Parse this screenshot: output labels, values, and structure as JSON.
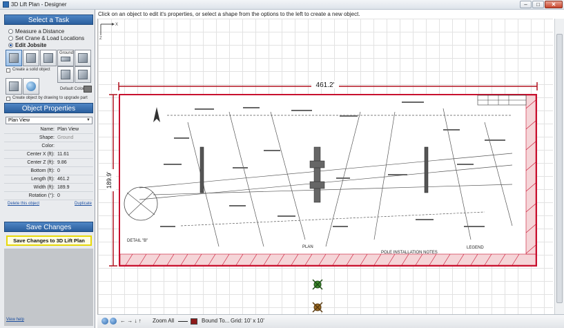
{
  "window": {
    "title": "3D Lift Plan - Designer",
    "minimize_glyph": "–",
    "maximize_glyph": "□",
    "close_glyph": "✕"
  },
  "left_panel": {
    "task_header": "Select a Task",
    "tasks": [
      {
        "label": "Measure a Distance",
        "selected": false
      },
      {
        "label": "Set Crane & Load Locations",
        "selected": false
      },
      {
        "label": "Edit Jobsite",
        "selected": true
      }
    ],
    "shape_labels": {
      "create_solid": "Create a solid object",
      "create_cutout": "Create object by drawing to upgrade part",
      "ground": "Ground",
      "default_color": "Default Color"
    },
    "properties_header": "Object Properties",
    "view_select": "Plan View",
    "properties": [
      {
        "label": "Name:",
        "value": "Plan View",
        "muted": false
      },
      {
        "label": "Shape:",
        "value": "Ground",
        "muted": true
      },
      {
        "label": "Color:",
        "value": "",
        "muted": false
      },
      {
        "label": "Center X (ft):",
        "value": "11.61",
        "muted": false
      },
      {
        "label": "Center Z (ft):",
        "value": "9.86",
        "muted": false
      },
      {
        "label": "Bottom (ft):",
        "value": "0",
        "muted": false
      },
      {
        "label": "Length (ft):",
        "value": "461.2",
        "muted": false
      },
      {
        "label": "Width (ft):",
        "value": "189.9",
        "muted": false
      },
      {
        "label": "Rotation (°):",
        "value": "0",
        "muted": false
      }
    ],
    "delete_link": "Delete this object",
    "duplicate_link": "Duplicate",
    "save_header": "Save Changes",
    "save_button": "Save Changes to 3D Lift Plan",
    "view_help_link": "View help"
  },
  "canvas": {
    "instruction": "Click on an object to edit it's properties, or select a shape from the options to the left to create a new object.",
    "axis_x_label": "X",
    "axis_z_label": "Z",
    "width_dimension": "461.2'",
    "height_dimension": "189.9'",
    "plan_labels": {
      "detail": "DETAIL \"B\"",
      "plan": "PLAN",
      "pole_installation": "POLE INSTALLATION NOTES",
      "legend": "LEGEND"
    },
    "accent_color": "#c8102e"
  },
  "toolbar": {
    "zoom_all": "Zoom All",
    "bound_to": "Bound To...",
    "grid": "Grid: 10' x 10'",
    "arrows": "← → ↓ ↑"
  }
}
